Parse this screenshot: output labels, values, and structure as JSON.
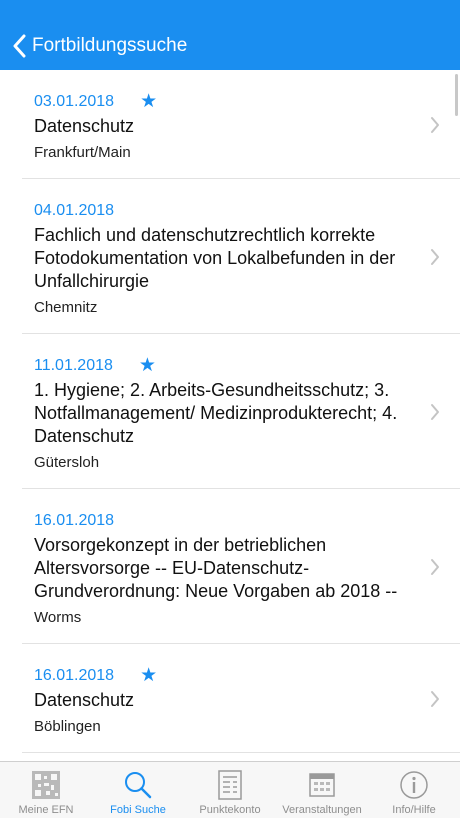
{
  "header": {
    "back_label": "Fortbildungssuche"
  },
  "colors": {
    "accent": "#1a8ef0",
    "nav_bg": "#1a8ef0",
    "tab_inactive": "#8e8e8e"
  },
  "events": [
    {
      "date": "03.01.2018",
      "starred": true,
      "title": "Datenschutz",
      "city": "Frankfurt/Main"
    },
    {
      "date": "04.01.2018",
      "starred": false,
      "title": "Fachlich und datenschutzrechtlich korrekte Fotodokumentation von Lokalbefunden in der Unfallchirurgie",
      "city": "Chemnitz"
    },
    {
      "date": "11.01.2018",
      "starred": true,
      "title": "1. Hygiene; 2. Arbeits-Gesundheitsschutz; 3. Notfallmanagement/ Medizinprodukterecht; 4. Datenschutz",
      "city": "Gütersloh"
    },
    {
      "date": "16.01.2018",
      "starred": false,
      "title": "Vorsorgekonzept in der betrieblichen Altersvorsorge -- EU-Datenschutz-Grundverordnung: Neue Vorgaben ab 2018 --",
      "city": "Worms"
    },
    {
      "date": "16.01.2018",
      "starred": true,
      "title": "Datenschutz",
      "city": "Böblingen"
    }
  ],
  "star_glyph": "★",
  "tabs": [
    {
      "label": "Meine EFN",
      "icon": "barcode-icon",
      "active": false
    },
    {
      "label": "Fobi Suche",
      "icon": "search-icon",
      "active": true
    },
    {
      "label": "Punktekonto",
      "icon": "ledger-icon",
      "active": false
    },
    {
      "label": "Veranstaltungen",
      "icon": "calendar-icon",
      "active": false
    },
    {
      "label": "Info/Hilfe",
      "icon": "info-icon",
      "active": false
    }
  ]
}
